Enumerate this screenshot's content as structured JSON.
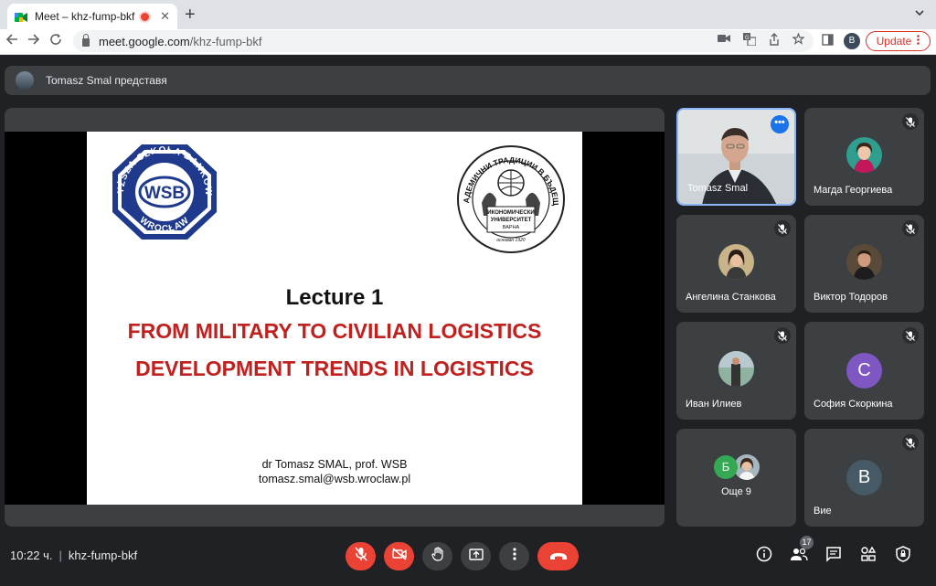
{
  "browser": {
    "tab_title": "Meet – khz-fump-bkf",
    "tab_close": "✕",
    "new_tab": "+",
    "url_host": "meet.google.com",
    "url_path": "/khz-fump-bkf",
    "profile_initial": "B",
    "update_label": "Update"
  },
  "presenting": {
    "text": "Tomasz Smal представя"
  },
  "slide": {
    "lecture": "Lecture 1",
    "line1": "FROM MILITARY TO CIVILIAN LOGISTICS",
    "line2": "DEVELOPMENT TRENDS IN LOGISTICS",
    "author": "dr Tomasz SMAL, prof. WSB",
    "email": "tomasz.smal@wsb.wroclaw.pl",
    "wsb_logo": {
      "top_text": "WYŻSZA SZKOŁA BANKOWA",
      "center": "WSB",
      "bottom_text": "WROCŁAW"
    },
    "ue_logo": {
      "ring_text": "С АКАДЕМИЧНИ ТРАДИЦИИ В БЪДЕЩЕТО",
      "line1": "ИКОНОМИЧЕСКИ",
      "line2": "УНИВЕРСИТЕТ",
      "line3": "ВАРНА",
      "line4": "основан 1920"
    }
  },
  "participants": [
    {
      "name": "Tomasz Smal",
      "more": "•••"
    },
    {
      "name": "Магда Георгиева"
    },
    {
      "name": "Ангелина Станкова"
    },
    {
      "name": "Виктор Тодоров"
    },
    {
      "name": "Иван Илиев"
    },
    {
      "name": "София Скоркина",
      "initial": "C"
    },
    {
      "name": "Още 9",
      "initial": "Б"
    },
    {
      "name": "Вие",
      "initial": "B"
    }
  ],
  "footer": {
    "time": "10:22 ч.",
    "separator": "|",
    "meeting_code": "khz-fump-bkf",
    "participant_count": "17"
  },
  "colors": {
    "accent_red": "#ea4335",
    "slide_red": "#c0201e",
    "wsb_blue": "#1f3a8c",
    "active_border": "#8ab4f8",
    "sofia_avatar": "#7e57c2",
    "you_avatar": "#455a64",
    "more_avatar": "#34a853"
  },
  "icons": [
    "meet-favicon",
    "recording-icon",
    "back-arrow-icon",
    "forward-arrow-icon",
    "reload-icon",
    "lock-icon",
    "camera-icon",
    "translate-icon",
    "share-icon",
    "star-icon",
    "sidepanel-icon",
    "mic-off-icon",
    "camera-off-icon",
    "raise-hand-icon",
    "present-icon",
    "more-vert-icon",
    "end-call-icon",
    "info-icon",
    "people-icon",
    "chat-icon",
    "activities-icon",
    "host-controls-icon"
  ]
}
